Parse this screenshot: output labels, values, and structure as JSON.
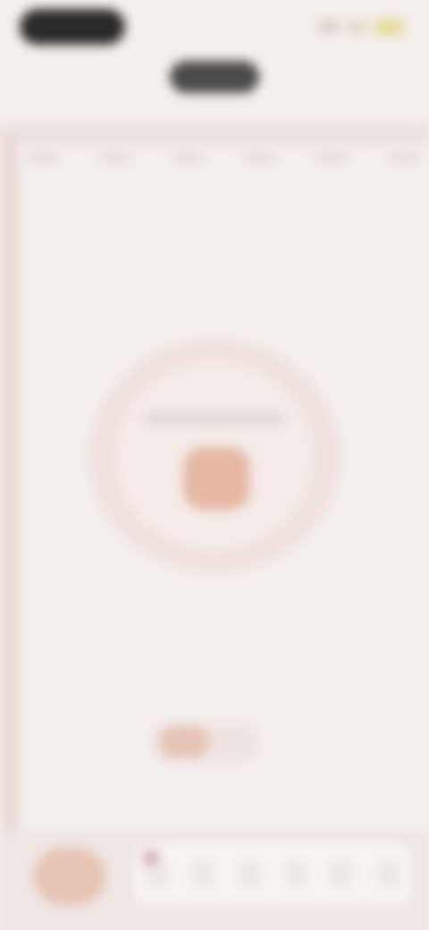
{
  "status_bar": {
    "time": "",
    "icons": [
      "signal-icon",
      "wifi-icon",
      "battery-icon"
    ]
  },
  "header": {
    "title": ""
  },
  "tabs": [
    "",
    "",
    "",
    "",
    "",
    ""
  ],
  "center": {
    "label": ""
  },
  "bottom": {
    "items": [
      "",
      "",
      "",
      "",
      "",
      ""
    ]
  },
  "colors": {
    "background": "#f3efec",
    "accent": "#e5b8a4",
    "ring": "#f0e2dc",
    "pill_dark": "#2a2a2a"
  }
}
